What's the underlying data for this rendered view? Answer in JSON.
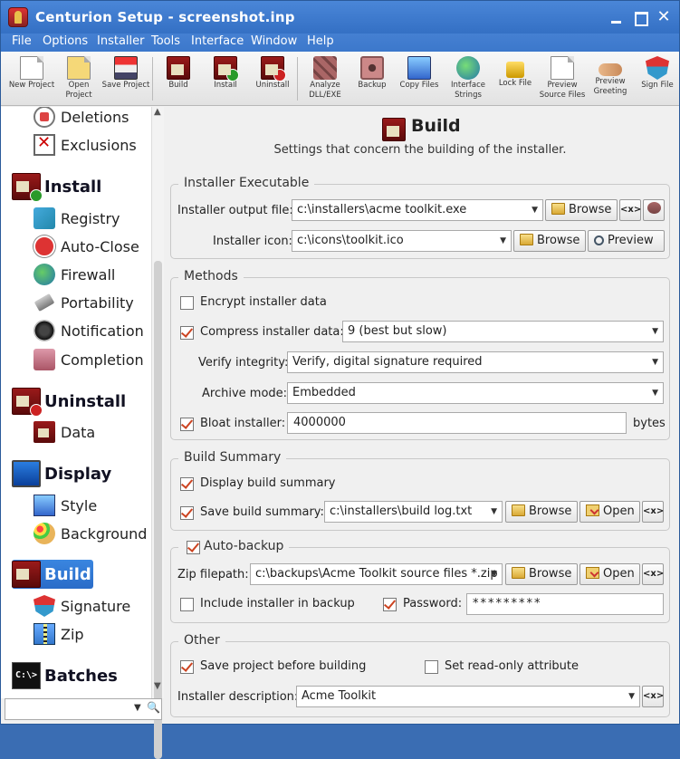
{
  "window": {
    "title": "Centurion Setup - screenshot.inp",
    "close_glyph": "✕"
  },
  "menu": [
    "File",
    "Options",
    "Installer",
    "Tools",
    "Interface",
    "Window",
    "Help"
  ],
  "toolbar": [
    {
      "label": "New Project",
      "icon": "new-project-icon"
    },
    {
      "label": "Open Project",
      "icon": "open-project-icon"
    },
    {
      "label": "Save Project",
      "icon": "save-project-icon"
    },
    {
      "label": "Build",
      "icon": "build-icon"
    },
    {
      "label": "Install",
      "icon": "install-icon"
    },
    {
      "label": "Uninstall",
      "icon": "uninstall-icon"
    },
    {
      "label": "Analyze DLL/EXE",
      "icon": "analyze-icon"
    },
    {
      "label": "Backup",
      "icon": "backup-icon"
    },
    {
      "label": "Copy Files",
      "icon": "copy-files-icon"
    },
    {
      "label": "Interface Strings",
      "icon": "interface-strings-icon"
    },
    {
      "label": "Lock File",
      "icon": "lock-icon"
    },
    {
      "label": "Preview Source Files",
      "icon": "preview-source-icon"
    },
    {
      "label": "Preview Greeting",
      "icon": "preview-greeting-icon"
    },
    {
      "label": "Sign File",
      "icon": "sign-icon"
    }
  ],
  "sidebar": {
    "items": {
      "deletions": "Deletions",
      "exclusions": "Exclusions",
      "install": "Install",
      "registry": "Registry",
      "autoclose": "Auto-Close",
      "firewall": "Firewall",
      "portability": "Portability",
      "notification": "Notification",
      "completion": "Completion",
      "uninstall": "Uninstall",
      "data": "Data",
      "display": "Display",
      "style": "Style",
      "background": "Background",
      "build": "Build",
      "signature": "Signature",
      "zip": "Zip",
      "batches": "Batches"
    },
    "selected": "Build",
    "scroll_up": "▲",
    "scroll_down": "▼",
    "search_arrow": "▼"
  },
  "page": {
    "title": "Build",
    "subtitle": "Settings that concern the building of the installer."
  },
  "executable": {
    "group": "Installer Executable",
    "output_label": "Installer output file:",
    "output_value": "c:\\installers\\acme toolkit.exe",
    "icon_label": "Installer icon:",
    "icon_value": "c:\\icons\\toolkit.ico",
    "browse": "Browse",
    "preview": "Preview",
    "var_btn": "<x>"
  },
  "methods": {
    "group": "Methods",
    "encrypt": "Encrypt installer data",
    "encrypt_checked": false,
    "compress": "Compress installer data:",
    "compress_checked": true,
    "compress_value": "9 (best but slow)",
    "verify_label": "Verify integrity:",
    "verify_value": "Verify, digital signature required",
    "archive_label": "Archive mode:",
    "archive_value": "Embedded",
    "bloat": "Bloat installer:",
    "bloat_checked": true,
    "bloat_value": "4000000",
    "bloat_unit": "bytes"
  },
  "summary": {
    "group": "Build Summary",
    "display": "Display build summary",
    "display_checked": true,
    "save": "Save build summary:",
    "save_checked": true,
    "save_value": "c:\\installers\\build log.txt",
    "browse": "Browse",
    "open": "Open",
    "var_btn": "<x>"
  },
  "backup": {
    "group": "Auto-backup",
    "group_checked": true,
    "zip_label": "Zip filepath:",
    "zip_value": "c:\\backups\\Acme Toolkit source files *.zip",
    "browse": "Browse",
    "open": "Open",
    "var_btn": "<x>",
    "include": "Include installer in backup",
    "include_checked": false,
    "password_label": "Password:",
    "password_checked": true,
    "password_value": "*********"
  },
  "other": {
    "group": "Other",
    "save_project": "Save project before building",
    "save_project_checked": true,
    "readonly": "Set read-only attribute",
    "readonly_checked": false,
    "desc_label": "Installer description:",
    "desc_value": "Acme Toolkit",
    "var_btn": "<x>"
  }
}
